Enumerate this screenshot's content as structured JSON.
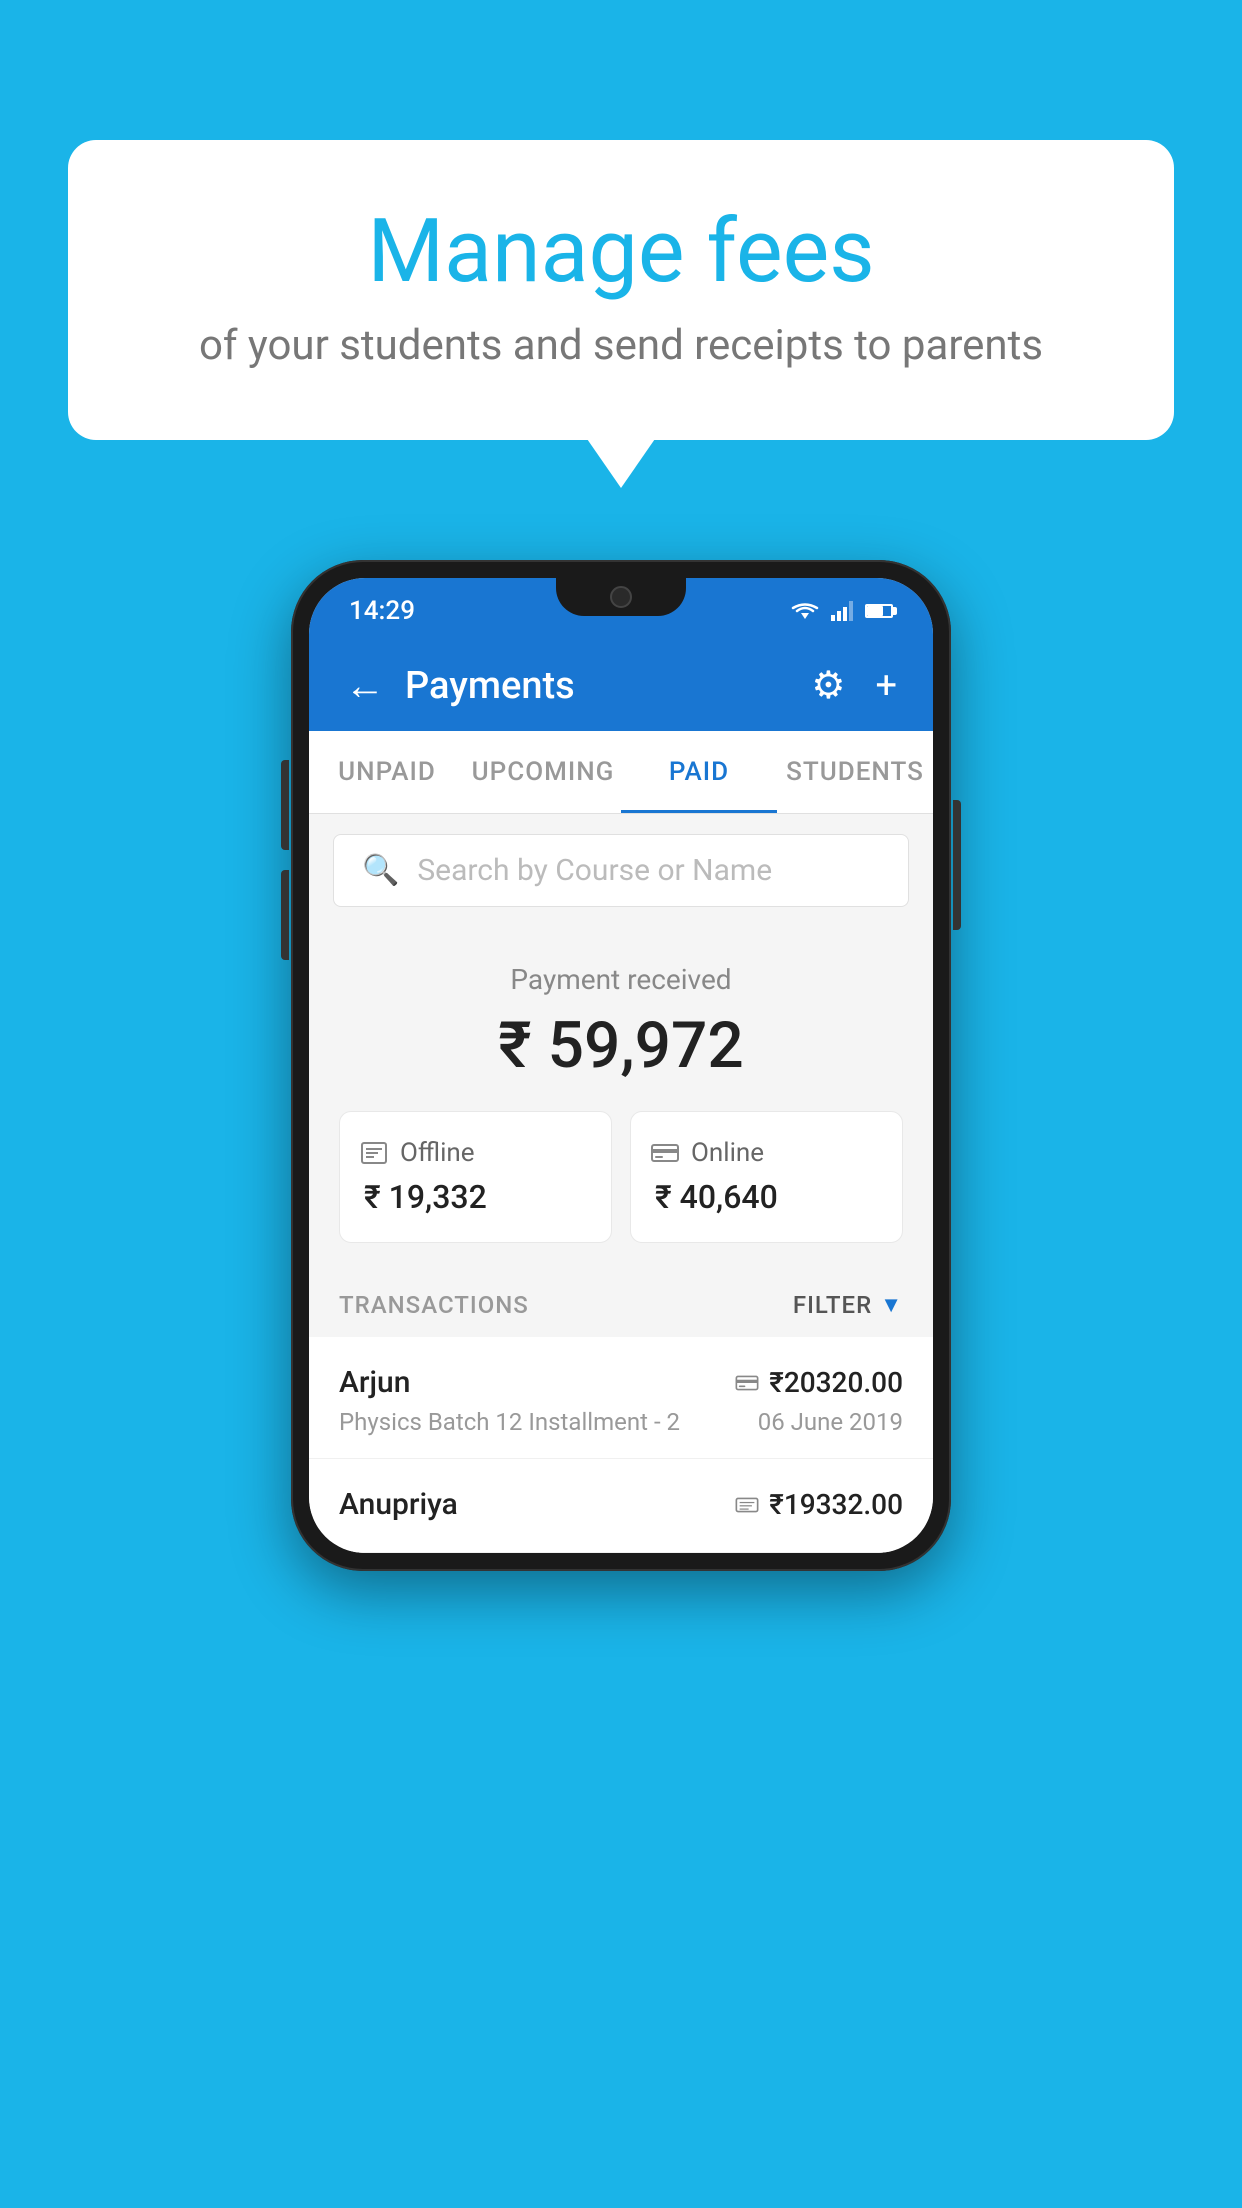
{
  "background_color": "#1ab4e8",
  "speech_bubble": {
    "title": "Manage fees",
    "subtitle": "of your students and send receipts to parents"
  },
  "phone": {
    "status_bar": {
      "time": "14:29"
    },
    "header": {
      "title": "Payments",
      "back_label": "←",
      "gear_label": "⚙",
      "plus_label": "+"
    },
    "tabs": [
      {
        "label": "UNPAID",
        "active": false
      },
      {
        "label": "UPCOMING",
        "active": false
      },
      {
        "label": "PAID",
        "active": true
      },
      {
        "label": "STUDENTS",
        "active": false
      }
    ],
    "search": {
      "placeholder": "Search by Course or Name"
    },
    "payment_summary": {
      "label": "Payment received",
      "amount": "₹ 59,972",
      "offline": {
        "label": "Offline",
        "amount": "₹ 19,332"
      },
      "online": {
        "label": "Online",
        "amount": "₹ 40,640"
      }
    },
    "transactions": {
      "label": "TRANSACTIONS",
      "filter_label": "FILTER",
      "items": [
        {
          "name": "Arjun",
          "description": "Physics Batch 12 Installment - 2",
          "amount": "₹20320.00",
          "date": "06 June 2019",
          "method": "online"
        },
        {
          "name": "Anupriya",
          "description": "",
          "amount": "₹19332.00",
          "date": "",
          "method": "offline"
        }
      ]
    }
  }
}
